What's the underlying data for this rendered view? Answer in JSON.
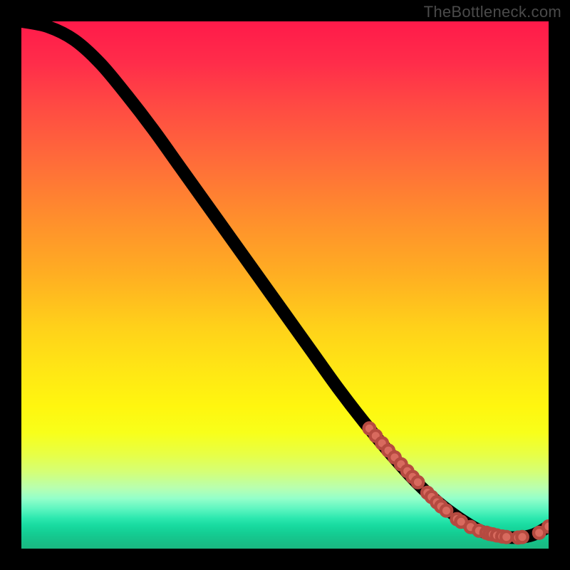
{
  "watermark": "TheBottleneck.com",
  "chart_data": {
    "type": "line",
    "title": "",
    "xlabel": "",
    "ylabel": "",
    "xlim": [
      0,
      100
    ],
    "ylim": [
      0,
      100
    ],
    "grid": false,
    "legend": false,
    "background": "rainbow-vertical-gradient",
    "series": [
      {
        "name": "bottleneck-curve",
        "x": [
          0,
          5,
          10,
          15,
          20,
          25,
          30,
          35,
          40,
          45,
          50,
          55,
          60,
          65,
          70,
          75,
          80,
          85,
          88,
          91,
          94,
          97,
          100
        ],
        "y": [
          100,
          99,
          96.5,
          92,
          86,
          79.5,
          72.5,
          65.5,
          58.5,
          51.5,
          44.5,
          37.5,
          30.5,
          24,
          18,
          12.5,
          8,
          4.5,
          3.0,
          2.3,
          2.1,
          2.6,
          4.2
        ]
      }
    ],
    "points": {
      "name": "highlighted-segment-dots",
      "coords": [
        [
          66.0,
          22.8
        ],
        [
          67.2,
          21.4
        ],
        [
          68.4,
          20.0
        ],
        [
          69.6,
          18.6
        ],
        [
          70.8,
          17.3
        ],
        [
          72.0,
          16.0
        ],
        [
          73.2,
          14.7
        ],
        [
          74.2,
          13.6
        ],
        [
          75.2,
          12.6
        ],
        [
          77.0,
          10.6
        ],
        [
          77.8,
          9.8
        ],
        [
          78.8,
          8.8
        ],
        [
          79.6,
          8.0
        ],
        [
          80.6,
          7.2
        ],
        [
          82.6,
          5.6
        ],
        [
          83.4,
          5.1
        ],
        [
          85.2,
          4.1
        ],
        [
          86.8,
          3.4
        ],
        [
          88.2,
          3.0
        ],
        [
          88.8,
          2.8
        ],
        [
          89.4,
          2.7
        ],
        [
          90.2,
          2.5
        ],
        [
          91.2,
          2.3
        ],
        [
          92.0,
          2.2
        ],
        [
          94.2,
          2.1
        ],
        [
          95.0,
          2.2
        ],
        [
          98.2,
          3.0
        ],
        [
          100.0,
          4.2
        ]
      ]
    }
  }
}
